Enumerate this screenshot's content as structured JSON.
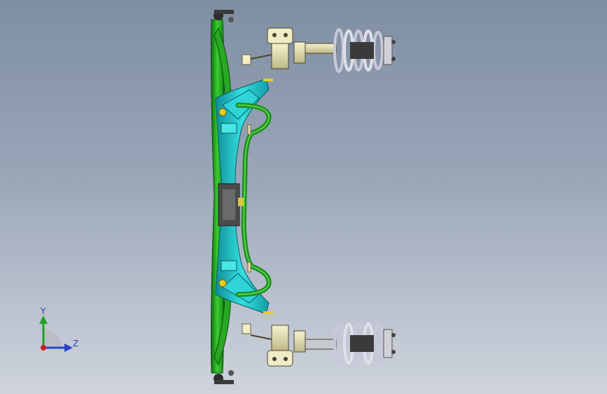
{
  "viewport": {
    "background_top": "#7f8ea2",
    "background_bottom": "#cfd4dc"
  },
  "model": {
    "subframe_color": "#1fc8cc",
    "arm_color": "#22a022",
    "strut_color": "#e6e0b0",
    "spring_color": "#dcdce6"
  },
  "triad": {
    "y_label": "Y",
    "z_label": "Z",
    "y_color": "#22a022",
    "z_color": "#2a46c8",
    "origin_color": "#cc2020"
  }
}
